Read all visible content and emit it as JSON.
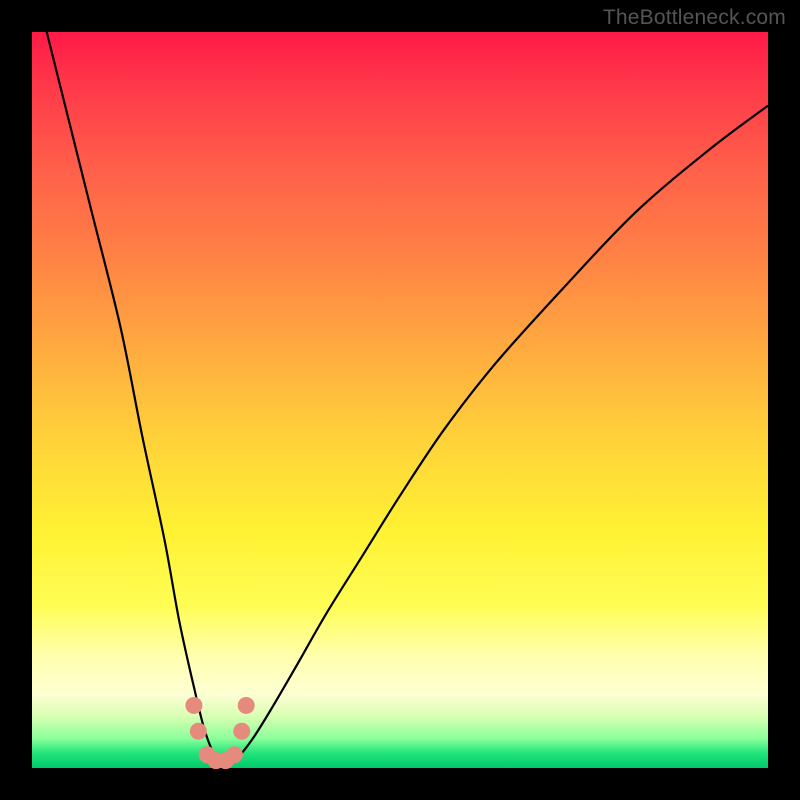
{
  "watermark": "TheBottleneck.com",
  "chart_data": {
    "type": "line",
    "title": "",
    "xlabel": "",
    "ylabel": "",
    "xlim": [
      0,
      100
    ],
    "ylim": [
      0,
      100
    ],
    "background_gradient": {
      "top_color": "#ff1a47",
      "mid_color": "#fff233",
      "bottom_color": "#00c96b",
      "meaning": "red=high bottleneck, green=low bottleneck"
    },
    "series": [
      {
        "name": "bottleneck-curve",
        "color": "#000000",
        "x": [
          0,
          4,
          8,
          12,
          15,
          18,
          20,
          22,
          23.5,
          25,
          26.5,
          28,
          30,
          32.5,
          36,
          40,
          45,
          50,
          56,
          63,
          72,
          82,
          92,
          100
        ],
        "values": [
          108,
          92,
          76,
          60,
          45,
          31,
          20,
          11,
          5,
          1.5,
          0.8,
          1.5,
          4,
          8,
          14,
          21,
          29,
          37,
          46,
          55,
          65,
          75.5,
          84,
          90
        ]
      }
    ],
    "minimum_markers": {
      "color": "#e68a7e",
      "points_x": [
        22.0,
        22.6,
        23.8,
        25.0,
        26.3,
        27.5,
        28.5,
        29.1
      ],
      "points_y": [
        8.5,
        5.0,
        1.8,
        1.0,
        1.0,
        1.8,
        5.0,
        8.5
      ]
    },
    "optimal_x": 26
  }
}
